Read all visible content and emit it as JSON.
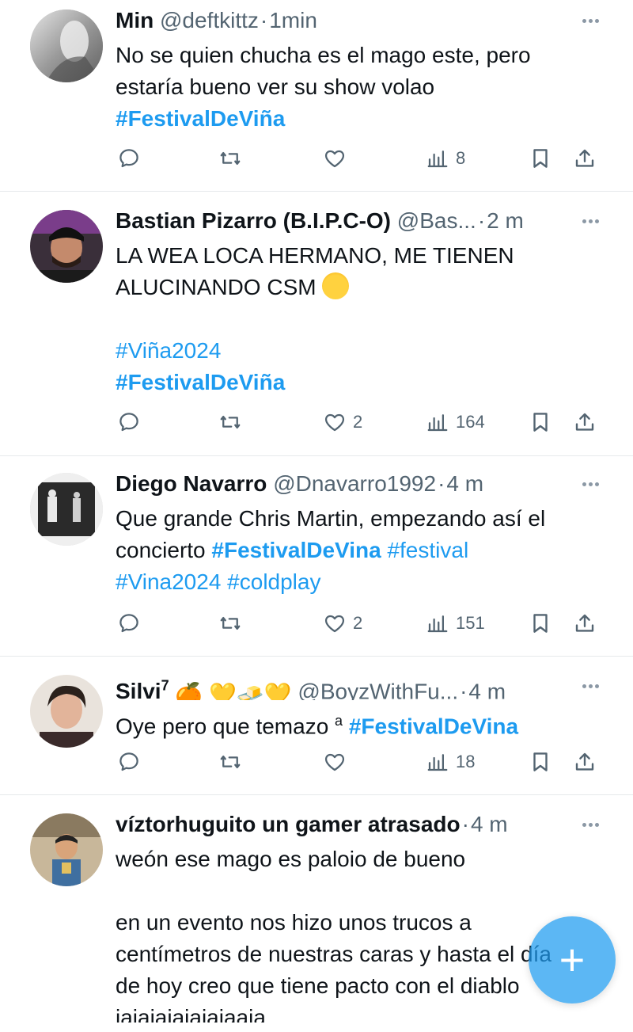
{
  "colors": {
    "accent": "#1d9bf0",
    "muted": "#536471",
    "text": "#0f1419",
    "divider": "#e6e9eb"
  },
  "tweets": [
    {
      "name": "Min",
      "handle": "@deftkittz",
      "time": "1min",
      "lines": [
        "No se quien chucha es el mago este, pero",
        "estaría bueno ver su show volao"
      ],
      "tags": [
        "#FestivalDeViña"
      ],
      "stats": {
        "replies": "",
        "retweets": "",
        "likes": "",
        "views": "8"
      }
    },
    {
      "name": "Bastian Pizarro (B.I.P.C-O)",
      "handle": "@Bas...",
      "time": "2 m",
      "lines": [
        "LA WEA LOCA HERMANO, ME TIENEN",
        "ALUCINANDO CSM"
      ],
      "emoji": "exploding-head",
      "tags": [
        "#Viña2024",
        "#FestivalDeViña"
      ],
      "stats": {
        "replies": "",
        "retweets": "",
        "likes": "2",
        "views": "164"
      }
    },
    {
      "name": "Diego Navarro",
      "handle": "@Dnavarro1992",
      "time": "4 m",
      "line1": "Que grande Chris Martin, empezando así el",
      "line2_text": "concierto ",
      "line2_tag1": "#FestivalDeVina",
      "line2_tag2": " #festival",
      "line3_tags": "#Vina2024 #coldplay",
      "stats": {
        "replies": "",
        "retweets": "",
        "likes": "2",
        "views": "151"
      }
    },
    {
      "name": "Silvi",
      "name_sup": "7",
      "name_emojis": "🍊 💛🧈💛",
      "handle": "@BoyzWithFu...",
      "time": "4 m",
      "text": "Oye pero que temazo ",
      "text_sup": "a",
      "tag": "#FestivalDeVina",
      "stats": {
        "replies": "",
        "retweets": "",
        "likes": "",
        "views": "18"
      }
    },
    {
      "name": "víztorhuguito un gamer atrasado",
      "handle": "",
      "time": "4 m",
      "lines": [
        "weón ese mago es paloio de bueno",
        "",
        "en un evento nos hizo unos trucos a",
        "centímetros de nuestras caras y hasta el día",
        "de hoy creo que tiene pacto con el diablo",
        "jajajajajajajaaja"
      ]
    }
  ],
  "fab": {
    "label": "+"
  },
  "icons": [
    "reply-icon",
    "retweet-icon",
    "like-icon",
    "views-icon",
    "bookmark-icon",
    "share-icon",
    "more-icon"
  ]
}
